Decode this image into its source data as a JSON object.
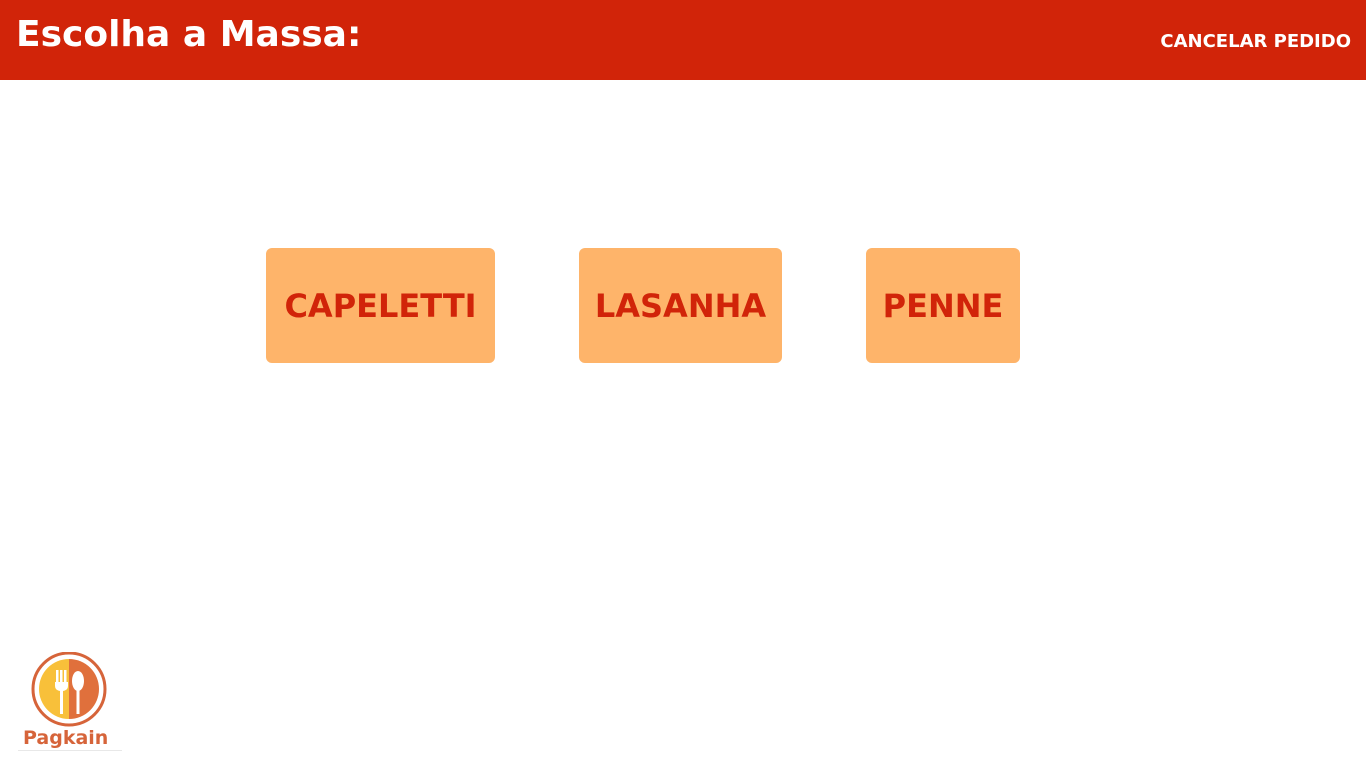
{
  "header": {
    "title": "Escolha a Massa:",
    "cancel_label": "CANCELAR PEDIDO"
  },
  "options": [
    {
      "label": "CAPELETTI"
    },
    {
      "label": "LASANHA"
    },
    {
      "label": "PENNE"
    }
  ],
  "logo": {
    "text": "Pagkain",
    "icon": "fork-and-spoon-plate-icon"
  },
  "colors": {
    "header_background": "#d12409",
    "header_text": "#ffffff",
    "option_background": "#feb46a",
    "option_text": "#d12409",
    "logo_accent": "#d6643a",
    "logo_yellow": "#f8c03a"
  }
}
